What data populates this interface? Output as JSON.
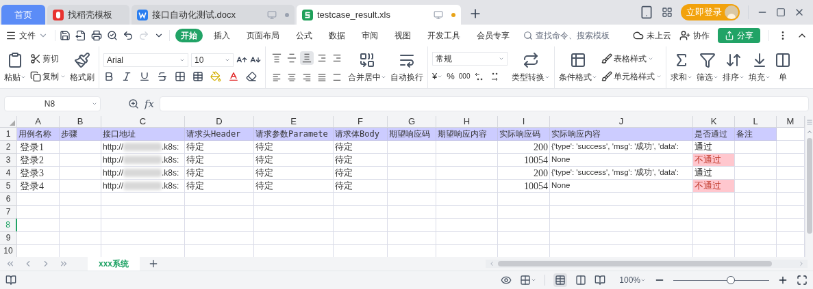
{
  "tabs": [
    {
      "label": "首页",
      "kind": "home",
      "selected": false
    },
    {
      "label": "找稻壳模板",
      "kind": "app",
      "selected": false
    },
    {
      "label": "接口自动化测试.docx",
      "kind": "doc",
      "selected": false
    },
    {
      "label": "testcase_result.xls",
      "kind": "sheet",
      "selected": true
    }
  ],
  "login": "立即登录",
  "menu": {
    "file": "文件",
    "tabs": [
      {
        "label": "开始",
        "selected": true
      },
      {
        "label": "插入",
        "selected": false
      },
      {
        "label": "页面布局",
        "selected": false
      },
      {
        "label": "公式",
        "selected": false
      },
      {
        "label": "数据",
        "selected": false
      },
      {
        "label": "审阅",
        "selected": false
      },
      {
        "label": "视图",
        "selected": false
      },
      {
        "label": "开发工具",
        "selected": false
      },
      {
        "label": "会员专享",
        "selected": false
      }
    ],
    "search_placeholder": "查找命令、搜索模板",
    "cloud": "未上云",
    "collab": "协作",
    "share": "分享"
  },
  "ribbon": {
    "paste": "粘贴",
    "cut": "剪切",
    "copy": "复制",
    "format_painter": "格式刷",
    "font": "Arial",
    "size": "10",
    "align_buttons": [
      {
        "kind": "top",
        "selected": false
      },
      {
        "kind": "middle",
        "selected": false
      },
      {
        "kind": "bottom",
        "selected": true
      },
      {
        "kind": "outdent",
        "selected": false
      },
      {
        "kind": "indent",
        "selected": false
      },
      {
        "kind": "left",
        "selected": false
      },
      {
        "kind": "center",
        "selected": false
      },
      {
        "kind": "right",
        "selected": false
      },
      {
        "kind": "justify",
        "selected": false
      },
      {
        "kind": "distribute",
        "selected": false
      }
    ],
    "merge": "合并居中",
    "wrap": "自动换行",
    "number_format": "常规",
    "currency": "¥",
    "percent": "%",
    "thousands": "000",
    "convert": "类型转换",
    "conditional": "条件格式",
    "table_style": "表格样式",
    "cell_style": "单元格样式",
    "sum": "求和",
    "filter": "筛选",
    "sort": "排序",
    "fill": "填充",
    "cells_cut": "单"
  },
  "name_box": "N8",
  "function_label": "fx",
  "columns": [
    "A",
    "B",
    "C",
    "D",
    "E",
    "F",
    "G",
    "H",
    "I",
    "J",
    "K",
    "L",
    "M"
  ],
  "header": [
    "用例名称",
    "步骤",
    "接口地址",
    "请求头Header",
    "请求参数Paramete",
    "请求体Body",
    "期望响应码",
    "期望响应内容",
    "实际响应码",
    "实际响应内容",
    "是否通过",
    "备注"
  ],
  "rows": [
    {
      "name": "登录1",
      "url_start": "http://",
      "url_end": ".k8s:",
      "header": "待定",
      "params": "待定",
      "body": "待定",
      "code": "200",
      "content": "{'type': 'success', 'msg': '成功', 'data':",
      "result": "通过",
      "passed": true
    },
    {
      "name": "登录2",
      "url_start": "http://",
      "url_end": ".k8s:",
      "header": "待定",
      "params": "待定",
      "body": "待定",
      "code": "10054",
      "content": "None",
      "result": "不通过",
      "passed": false
    },
    {
      "name": "登录3",
      "url_start": "http://",
      "url_end": ".k8s:",
      "header": "待定",
      "params": "待定",
      "body": "待定",
      "code": "200",
      "content": "{'type': 'success', 'msg': '成功', 'data':",
      "result": "通过",
      "passed": true
    },
    {
      "name": "登录4",
      "url_start": "http://",
      "url_end": ".k8s:",
      "header": "待定",
      "params": "待定",
      "body": "待定",
      "code": "10054",
      "content": "None",
      "result": "不通过",
      "passed": false
    }
  ],
  "row_numbers": [
    {
      "label": "1",
      "selected": false
    },
    {
      "label": "2",
      "selected": false
    },
    {
      "label": "3",
      "selected": false
    },
    {
      "label": "4",
      "selected": false
    },
    {
      "label": "5",
      "selected": false
    },
    {
      "label": "6",
      "selected": false
    },
    {
      "label": "7",
      "selected": false
    },
    {
      "label": "8",
      "selected": true
    },
    {
      "label": "9",
      "selected": false
    },
    {
      "label": "10",
      "selected": false
    }
  ],
  "sheets": [
    {
      "label": "xxx系统",
      "selected": true
    }
  ],
  "zoom": "100%",
  "zoom_level": {
    "level": 0.6
  }
}
